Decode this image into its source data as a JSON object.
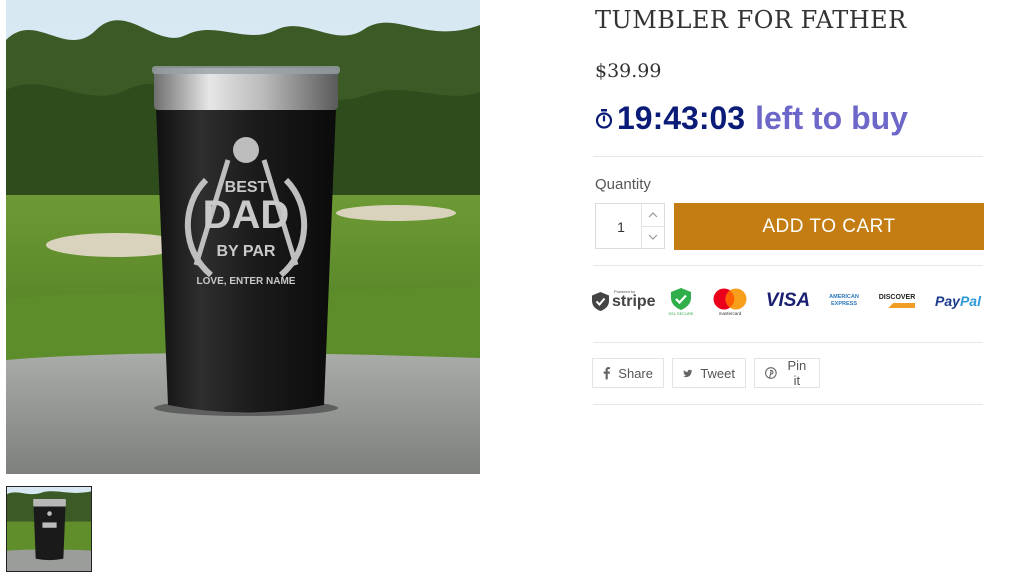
{
  "product": {
    "title": "TUMBLER FOR FATHER",
    "price": "$39.99",
    "images": {
      "engraving_line1": "BEST",
      "engraving_line2": "DAD",
      "engraving_line3": "BY PAR",
      "engraving_line4": "LOVE, ENTER NAME"
    }
  },
  "timer": {
    "icon": "stopwatch-icon",
    "time": "19:43:03",
    "label": "left to buy",
    "time_color": "#0b1b78",
    "label_color": "#6c67c8"
  },
  "quantity": {
    "label": "Quantity",
    "value": "1"
  },
  "cart": {
    "add_label": "ADD TO CART",
    "button_color": "#c47d12"
  },
  "payments": {
    "stripe_small": "Powered by",
    "stripe_word": "stripe",
    "ssl_text": "SSL SECURE",
    "mastercard_text": "mastercard",
    "visa": "VISA",
    "amex_line1": "AMERICAN",
    "amex_line2": "EXPRESS",
    "discover": "DISCOVER",
    "paypal_pay": "Pay",
    "paypal_pal": "Pal"
  },
  "share": {
    "facebook_label": "Share",
    "twitter_label": "Tweet",
    "pinterest_label": "Pin it"
  }
}
